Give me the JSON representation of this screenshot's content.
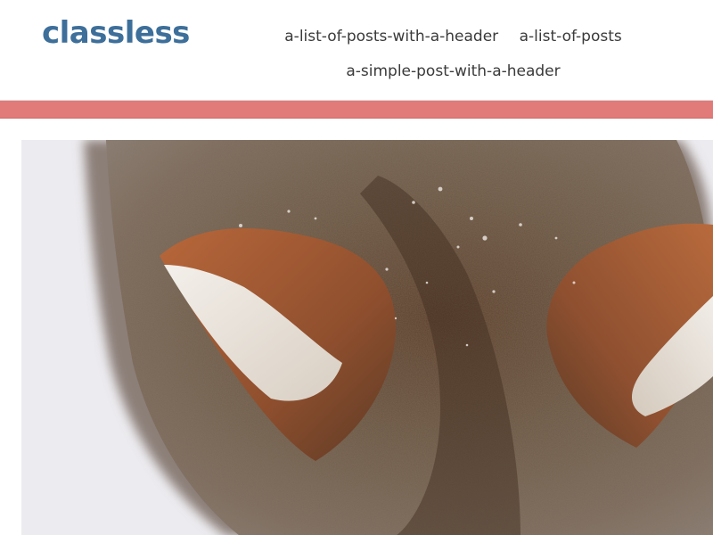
{
  "site": {
    "title": "classless"
  },
  "nav": {
    "links": [
      {
        "label": "a-list-of-posts-with-a-header"
      },
      {
        "label": "a-list-of-posts"
      },
      {
        "label": "a-simple-post-with-a-header"
      }
    ]
  },
  "colors": {
    "brand": "#3d6f9a",
    "accent_bar": "#e07b7a",
    "nav_text": "#3a3a3a",
    "background": "#ffffff"
  },
  "hero": {
    "subject": "fox photograph"
  }
}
